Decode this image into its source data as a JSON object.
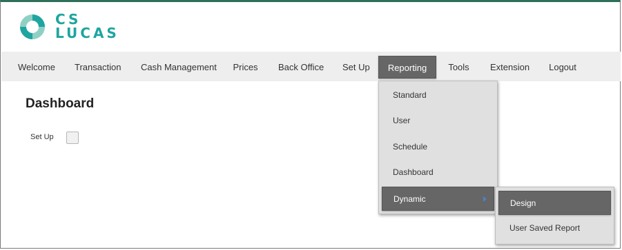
{
  "logo": {
    "line1": "CS",
    "line2": "LUCAS",
    "icon": "ring-logo-icon",
    "color": "#1fa5a0"
  },
  "nav": {
    "items": [
      {
        "label": "Welcome"
      },
      {
        "label": "Transaction"
      },
      {
        "label": "Cash Management"
      },
      {
        "label": "Prices"
      },
      {
        "label": "Back Office"
      },
      {
        "label": "Set Up"
      },
      {
        "label": "Reporting",
        "active": true
      },
      {
        "label": "Tools"
      },
      {
        "label": "Extension"
      },
      {
        "label": "Logout"
      }
    ]
  },
  "page": {
    "title": "Dashboard",
    "setup_label": "Set Up",
    "setup_checked": false
  },
  "reporting_menu": {
    "items": [
      {
        "label": "Standard"
      },
      {
        "label": "User"
      },
      {
        "label": "Schedule"
      },
      {
        "label": "Dashboard"
      },
      {
        "label": "Dynamic",
        "active": true,
        "icon": "chevron-right-icon"
      }
    ]
  },
  "dynamic_submenu": {
    "items": [
      {
        "label": "Design",
        "active": true
      },
      {
        "label": "User Saved Report"
      }
    ]
  },
  "colors": {
    "accent": "#1fa5a0",
    "active_bg": "#666666",
    "nav_bg": "#eeeeee",
    "menu_bg": "#e0e0e0"
  }
}
